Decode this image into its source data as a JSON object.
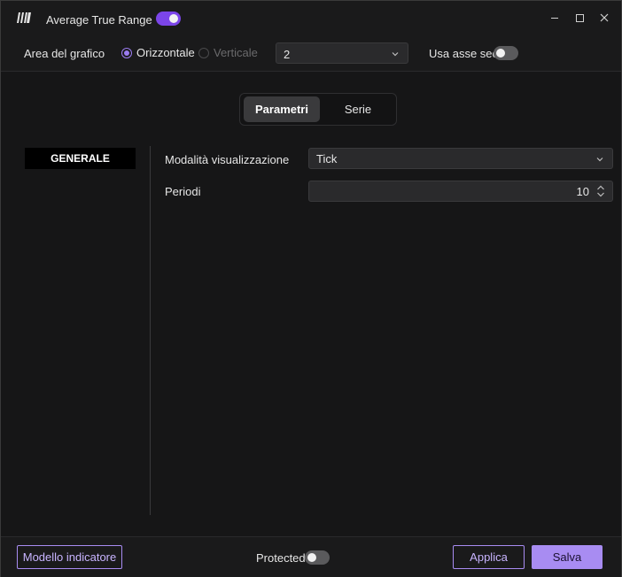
{
  "window": {
    "title": "Average True Range",
    "enabled": true,
    "controls": [
      "minimize-icon",
      "maximize-icon",
      "close-icon"
    ]
  },
  "options": {
    "area_label": "Area del grafico",
    "radio_horizontal": "Orizzontale",
    "radio_vertical": "Verticale",
    "selected_orientation": "Orizzontale",
    "area_select_value": "2",
    "secondary_axis_label": "Usa asse sec.",
    "secondary_axis_on": false
  },
  "tabs": {
    "items": [
      "Parametri",
      "Serie"
    ],
    "active": "Parametri"
  },
  "sidebar": {
    "items": [
      "GENERALE"
    ],
    "active": "GENERALE"
  },
  "form": {
    "display_mode_label": "Modalità visualizzazione",
    "display_mode_value": "Tick",
    "periods_label": "Periodi",
    "periods_value": "10"
  },
  "footer": {
    "template_button": "Modello indicatore",
    "protected_label": "Protected",
    "protected_on": false,
    "apply_button": "Applica",
    "save_button": "Salva"
  },
  "colors": {
    "accent": "#7b45e8",
    "accent_light": "#a88cf2",
    "background": "#161617",
    "input_bg": "#2a2a2c"
  }
}
